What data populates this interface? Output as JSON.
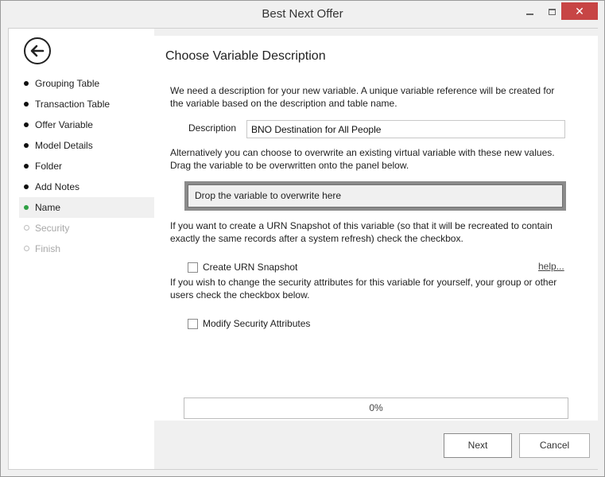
{
  "window": {
    "title": "Best Next Offer",
    "close_glyph": "✕",
    "accent_close": "#c74545"
  },
  "sidebar": {
    "back_icon": "back-arrow-icon",
    "steps": [
      {
        "label": "Grouping Table",
        "state": "done"
      },
      {
        "label": "Transaction Table",
        "state": "done"
      },
      {
        "label": "Offer Variable",
        "state": "done"
      },
      {
        "label": "Model Details",
        "state": "done"
      },
      {
        "label": "Folder",
        "state": "done"
      },
      {
        "label": "Add Notes",
        "state": "done"
      },
      {
        "label": "Name",
        "state": "active"
      },
      {
        "label": "Security",
        "state": "disabled"
      },
      {
        "label": "Finish",
        "state": "disabled"
      }
    ],
    "active_color": "#2ea043"
  },
  "main": {
    "heading": "Choose Variable Description",
    "intro": "We need a description for your new variable.  A unique variable reference will be created for the variable based on the description and table name.",
    "description_label": "Description",
    "description_value": "BNO Destination for All People",
    "overwrite_text": "Alternatively you can choose to overwrite an existing virtual variable with these new values. Drag the variable to be overwritten onto the panel below.",
    "drop_zone_text": "Drop the variable to overwrite here",
    "urn_text": "If you want to create a URN Snapshot of this variable (so that it will be recreated to contain exactly the same records after a system refresh) check the checkbox.",
    "urn_checkbox_label": "Create URN Snapshot",
    "urn_checked": false,
    "help_link": "help...",
    "security_text": "If you wish to change the security attributes for this variable for yourself, your group or other users check the checkbox below.",
    "security_checkbox_label": "Modify Security Attributes",
    "security_checked": false,
    "progress_text": "0%",
    "progress_value": 0
  },
  "footer": {
    "next_label": "Next",
    "cancel_label": "Cancel"
  }
}
